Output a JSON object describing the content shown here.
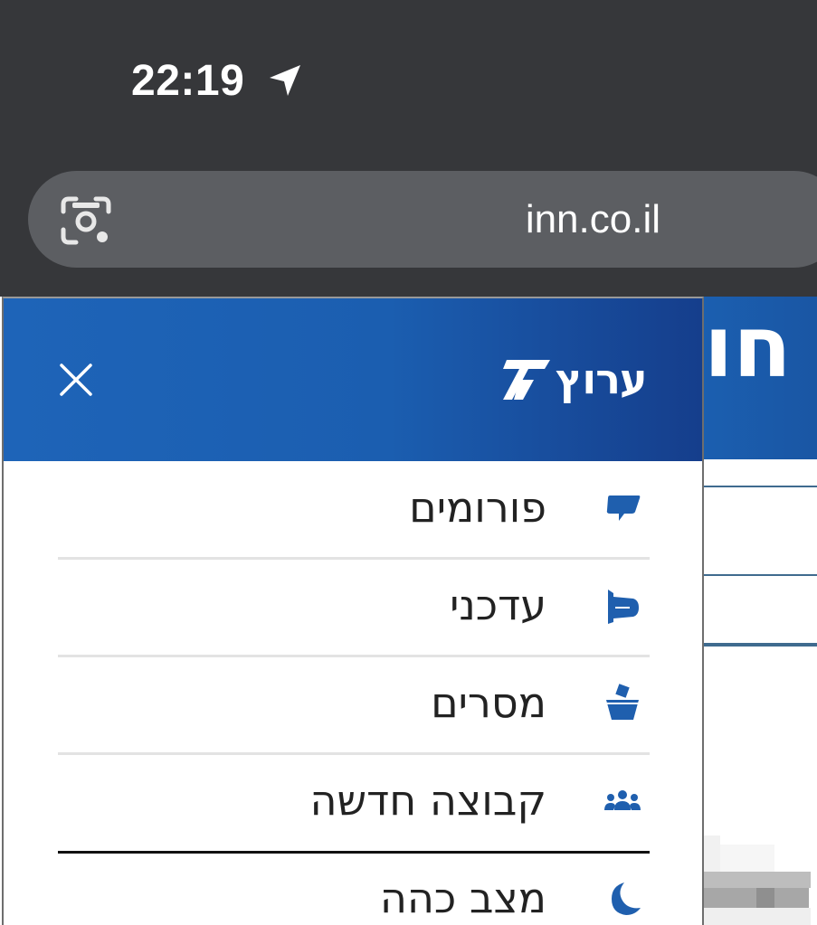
{
  "status_bar": {
    "time": "22:19",
    "location_icon": "location-arrow-icon"
  },
  "browser": {
    "url": "inn.co.il",
    "lens_icon": "google-lens-icon"
  },
  "background_page": {
    "header_fragment": "חו"
  },
  "drawer": {
    "logo_text": "ערוץ",
    "logo_icon": "channel-7-logo",
    "close_icon": "close-icon",
    "items": [
      {
        "label": "פורומים",
        "icon": "speech-bubble-icon"
      },
      {
        "label": "עדכני",
        "icon": "megaphone-icon"
      },
      {
        "label": "מסרים",
        "icon": "ballot-box-icon"
      },
      {
        "label": "קבוצה חדשה",
        "icon": "group-icon"
      },
      {
        "label": "מצב כהה",
        "icon": "moon-icon"
      }
    ]
  },
  "colors": {
    "chrome_bg": "#36373a",
    "urlbar_bg": "#5c5e62",
    "header_blue": "#1e64b8",
    "icon_blue": "#1f5fae",
    "text_dark": "#222222"
  }
}
